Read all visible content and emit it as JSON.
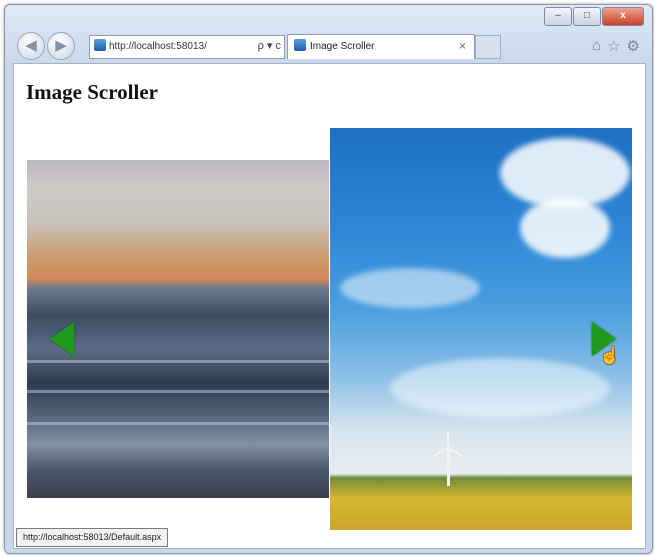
{
  "window": {
    "controls": {
      "minimize": "–",
      "maximize": "□",
      "close": "x"
    }
  },
  "toolbar": {
    "back_icon": "back-arrow-icon",
    "forward_icon": "forward-arrow-icon",
    "address": "http://localhost:58013/",
    "address_tools": "ρ ▾ c",
    "tab_title": "Image Scroller",
    "tab_close": "×",
    "right_icons": [
      "home-icon",
      "star-icon",
      "gear-icon"
    ]
  },
  "page": {
    "title": "Image Scroller"
  },
  "status_bar": {
    "text": "http://localhost:58013/Default.aspx"
  },
  "colors": {
    "arrow": "#1f9a1f",
    "sky": "#1d6fc3",
    "field": "#d7b731"
  }
}
